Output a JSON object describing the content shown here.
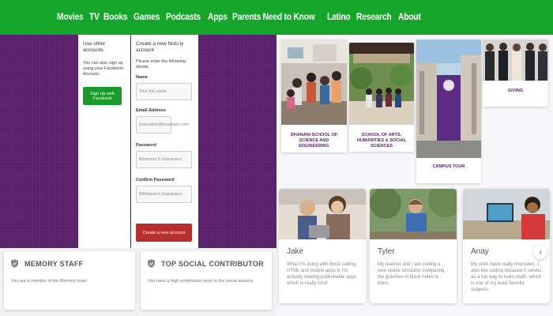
{
  "nav": [
    "Movies",
    "TV",
    "Books",
    "Games",
    "Podcasts",
    "Apps",
    "Parents Need to Know",
    "Latino",
    "Research",
    "About"
  ],
  "signup": {
    "left_title": "Use other accounts",
    "left_text": "You can also sign up using your Facebook Account.",
    "fb_button": "Sign Up with Facebook",
    "right_title": "Create a new Nolo.ly account",
    "right_sub": "Please enter the following details",
    "name_label": "Name",
    "name_placeholder": "Your full name",
    "email_label": "Email Address",
    "email_placeholder": "yourname@example.com",
    "password_label": "Password",
    "password_placeholder": "Minimum 6 characters",
    "confirm_label": "Confirm Password",
    "confirm_placeholder": "Minimum 6 characters",
    "create_button": "Create a new account"
  },
  "badges": [
    {
      "title": "MEMORY STAFF",
      "desc": "You are a member of the Memory team"
    },
    {
      "title": "TOP SOCIAL CONTRIBUTOR",
      "desc": "You have a high contribution level to the social aspects"
    }
  ],
  "tiles": [
    {
      "caption": "DHANANI SCHOOL OF SCIENCE AND ENGINEERING"
    },
    {
      "caption": "SCHOOL OF ARTS, HUMANITIES & SOCIAL SCIENCES"
    },
    {
      "caption": "CAMPUS TOUR"
    },
    {
      "caption": "GIVING"
    }
  ],
  "stories": [
    {
      "name": "Jake",
      "text": "What I'm doing with block coding, HTML and mobile apps is I'm actually making publishable apps which is really cool!"
    },
    {
      "name": "Tyler",
      "text": "My teacher and I are coding a new space simulator comparing the gravities of black holes to Mars."
    },
    {
      "name": "Anay",
      "text": "My skills have really improved...I also like coding because it serves as a fun way to learn math, which is one of my least favorite subjects."
    }
  ],
  "next_icon": "›",
  "colors": {
    "nav": "#15a52b",
    "purple": "#5a1f6e",
    "fb": "#1b9a2c",
    "create": "#b5302d"
  }
}
